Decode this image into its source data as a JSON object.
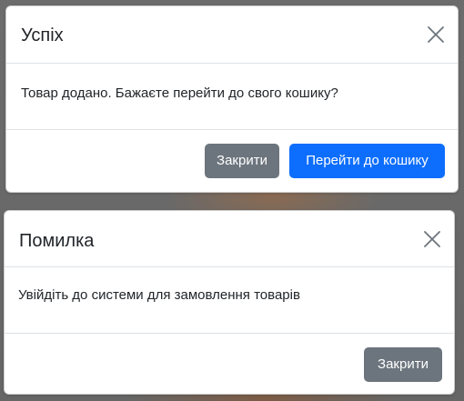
{
  "success_modal": {
    "title": "Успіх",
    "message": "Товар додано. Бажаєте перейти до свого кошику?",
    "close_label": "Закрити",
    "go_to_cart_label": "Перейти до кошику",
    "close_icon": "close-icon"
  },
  "error_modal": {
    "title": "Помилка",
    "message": "Увійдіть до системи для замовлення товарів",
    "close_label": "Закрити",
    "close_icon": "close-icon"
  },
  "colors": {
    "primary": "#0d6efd",
    "secondary": "#6c757d",
    "backdrop": "#6c6c6c"
  }
}
